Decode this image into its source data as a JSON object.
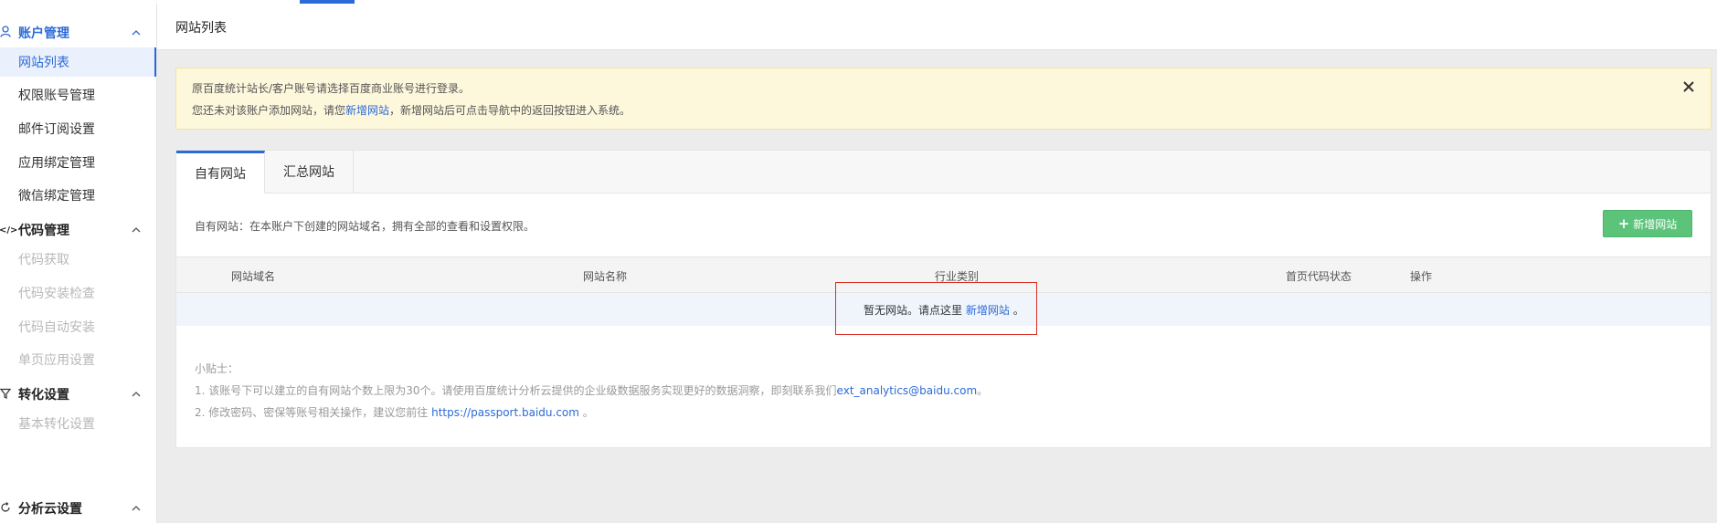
{
  "sidebar": {
    "groups": [
      {
        "label": "账户管理",
        "items": [
          "网站列表",
          "权限账号管理",
          "邮件订阅设置",
          "应用绑定管理",
          "微信绑定管理"
        ]
      },
      {
        "label": "代码管理",
        "items": [
          "代码获取",
          "代码安装检查",
          "代码自动安装",
          "单页应用设置"
        ]
      },
      {
        "label": "转化设置",
        "items": [
          "基本转化设置"
        ]
      },
      {
        "label": "分析云设置",
        "items": []
      }
    ],
    "code_glyph": "</>"
  },
  "header": {
    "title": "网站列表"
  },
  "alert": {
    "line1": "原百度统计站长/客户账号请选择百度商业账号进行登录。",
    "line2_pre": "您还未对该账户添加网站，请您",
    "line2_link": "新增网站",
    "line2_post": "，新增网站后可点击导航中的返回按钮进入系统。"
  },
  "tabs": [
    {
      "label": "自有网站",
      "active": true
    },
    {
      "label": "汇总网站",
      "active": false
    }
  ],
  "panel": {
    "description": "自有网站：在本账户下创建的网站域名，拥有全部的查看和设置权限。",
    "add_button_label": "新增网站",
    "columns": [
      "网站域名",
      "网站名称",
      "行业类别",
      "首页代码状态",
      "操作"
    ],
    "empty_pre": "暂无网站。请点这里",
    "empty_link": "新增网站",
    "empty_post": "。"
  },
  "tips": {
    "title": "小贴士：",
    "tip1_pre": "1. 该账号下可以建立的自有网站个数上限为30个。请使用百度统计分析云提供的企业级数据服务实现更好的数据洞察，即刻联系我们",
    "tip1_link": "ext_analytics@baidu.com",
    "tip1_post": "。",
    "tip2_pre": "2. 修改密码、密保等账号相关操作，建议您前往",
    "tip2_link": "https://passport.baidu.com",
    "tip2_post": "。"
  },
  "colors": {
    "accent": "#2c6bd6",
    "add_button": "#5cc47a",
    "alert_bg": "#fdf7dc",
    "highlight_border": "#d93025"
  }
}
